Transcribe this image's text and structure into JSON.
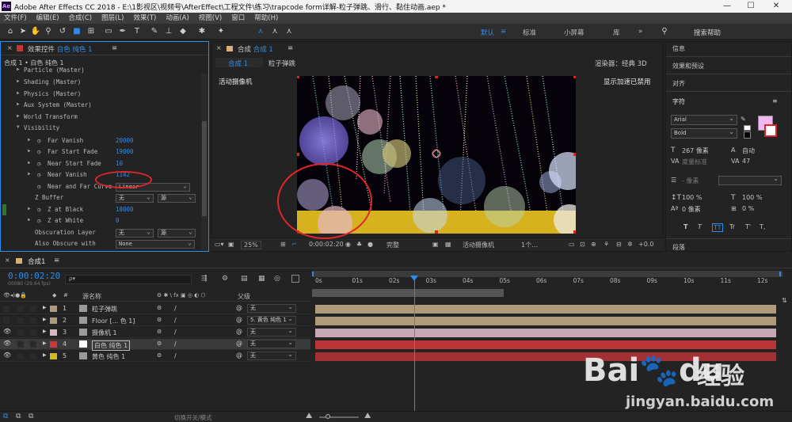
{
  "app": {
    "logo": "Ae",
    "title": "Adobe After Effects CC 2018 - E:\\1影视区\\视频号\\AfterEffect\\工程文件\\练习\\trapcode form详解-粒子弹跳、滑行、黏住动画.aep *",
    "min": "—",
    "max": "☐",
    "close": "✕"
  },
  "menu": [
    "文件(F)",
    "编辑(E)",
    "合成(C)",
    "图层(L)",
    "效果(T)",
    "动画(A)",
    "视图(V)",
    "窗口",
    "帮助(H)"
  ],
  "workspace": {
    "items": [
      "默认",
      "标准",
      "小屏幕",
      "库"
    ],
    "active": "默认",
    "menu": "≡",
    "more": "»",
    "search_placeholder": "搜索帮助"
  },
  "effects_panel": {
    "title_prefix": "效果控件",
    "title_layer": "白色 纯色 1",
    "menu": "≡",
    "breadcrumb": "合成 1 • 白色 纯色 1",
    "groups": [
      "Particle (Master)",
      "Shading (Master)",
      "Physics (Master)",
      "Aux System (Master)",
      "World Transform"
    ],
    "visibility_label": "Visibility",
    "params": [
      {
        "label": "Far Vanish",
        "value": "20000"
      },
      {
        "label": "Far Start Fade",
        "value": "19000"
      },
      {
        "label": "Near Start Fade",
        "value": "10"
      },
      {
        "label": "Near Vanish",
        "value": "1142"
      }
    ],
    "near_far_curve": {
      "label": "Near and Far Curve",
      "value": "Linear"
    },
    "z_buffer": {
      "label": "Z Buffer",
      "value": "无",
      "value2": "源"
    },
    "z_black": {
      "label": "Z at Black",
      "value": "10000"
    },
    "z_white": {
      "label": "Z at White",
      "value": "0"
    },
    "obscuration": {
      "label": "Obscuration Layer",
      "value": "无",
      "value2": "源"
    },
    "also_obscure": {
      "label": "Also Obscure with",
      "value": "None"
    }
  },
  "comp_panel": {
    "title_prefix": "合成",
    "title_name": "合成 1",
    "menu": "≡",
    "tabs": [
      "合成 1",
      "粒子弹跳"
    ],
    "renderer_label": "渲染器：",
    "renderer_value": "经典 3D",
    "camera_label": "活动摄像机",
    "gpu_label": "显示加速已禁用",
    "bottom": {
      "zoom": "25%",
      "timecode": "0:00:02:20",
      "quality": "完整",
      "camera": "活动摄像机",
      "views": "1个…",
      "exposure": "+0.0"
    }
  },
  "right_panel": {
    "sections": [
      "信息",
      "效果和预设",
      "对齐"
    ],
    "char_title": "字符",
    "font": "Arial",
    "style": "Bold",
    "size": "267 像素",
    "leading": "自动",
    "kerning": "度量标准",
    "tracking": "47",
    "stroke": "- 像素",
    "vscale": "100 %",
    "hscale": "100 %",
    "baseline": "0 像素",
    "tsume": "0 %",
    "styles": [
      "T",
      "T",
      "TT",
      "Tr",
      "T'",
      "T,"
    ],
    "para": "段落",
    "menu": "≡",
    "fill_color": "#f0b8f0"
  },
  "timeline": {
    "tab": "合成1",
    "menu": "≡",
    "timecode": "0:00:02:20",
    "fps": "00080 (29.64 fps)",
    "search_placeholder": "ρ▾",
    "col_source": "源名称",
    "col_parent": "父级",
    "ruler": [
      "0s",
      "01s",
      "02s",
      "03s",
      "04s",
      "05s",
      "06s",
      "07s",
      "08s",
      "09s",
      "10s",
      "11s",
      "12s"
    ],
    "layers": [
      {
        "num": "1",
        "name": "粒子弹跳",
        "color": "#b09a7c",
        "parent": "无",
        "bar": "#b09a7c",
        "eye": false
      },
      {
        "num": "2",
        "name": "Floor [... 色 1]",
        "color": "#b09a7c",
        "parent": "5. 黄色 纯色 1",
        "bar": "#b09a7c",
        "eye": false
      },
      {
        "num": "3",
        "name": "摄像机 1",
        "color": "#d9b7c1",
        "parent": "无",
        "bar": "#c8a8b4",
        "eye": true
      },
      {
        "num": "4",
        "name": "白色 纯色 1",
        "color": "#d2363c",
        "parent": "无",
        "bar": "#b8353a",
        "eye": true,
        "selected": true
      },
      {
        "num": "5",
        "name": "黄色 纯色 1",
        "color": "#d4b820",
        "parent": "无",
        "bar": "#a33037",
        "eye": true
      }
    ],
    "footer": "切换开关/模式"
  },
  "watermark": {
    "brand": "Bai",
    "brand2": "du",
    "cn": "经验",
    "url": "jingyan.baidu.com"
  }
}
